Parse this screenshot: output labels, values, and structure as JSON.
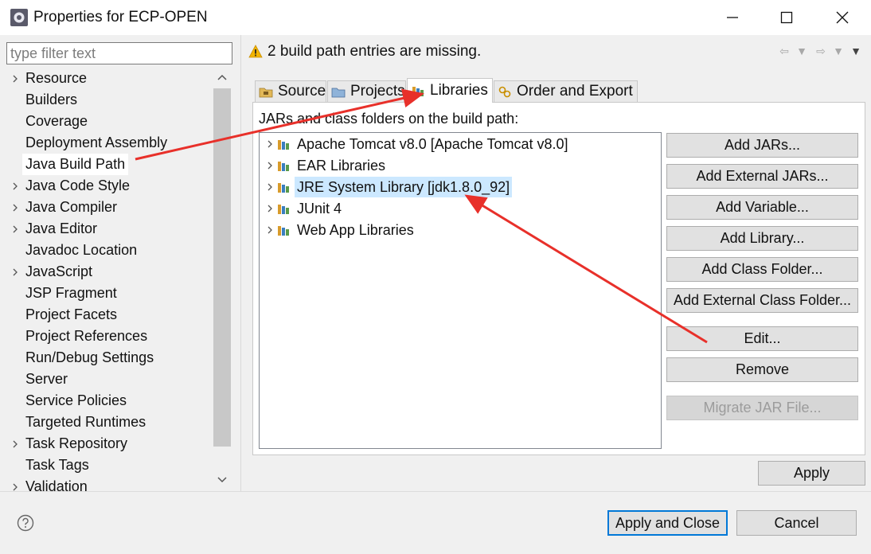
{
  "window": {
    "title": "Properties for ECP-OPEN",
    "minimize": "—",
    "maximize": "☐",
    "close": "✕"
  },
  "filter": {
    "placeholder": "type filter text"
  },
  "nav": {
    "items": [
      {
        "label": "Resource",
        "expandable": true
      },
      {
        "label": "Builders",
        "expandable": false
      },
      {
        "label": "Coverage",
        "expandable": false
      },
      {
        "label": "Deployment Assembly",
        "expandable": false
      },
      {
        "label": "Java Build Path",
        "expandable": false,
        "selected": true
      },
      {
        "label": "Java Code Style",
        "expandable": true
      },
      {
        "label": "Java Compiler",
        "expandable": true
      },
      {
        "label": "Java Editor",
        "expandable": true
      },
      {
        "label": "Javadoc Location",
        "expandable": false
      },
      {
        "label": "JavaScript",
        "expandable": true
      },
      {
        "label": "JSP Fragment",
        "expandable": false
      },
      {
        "label": "Project Facets",
        "expandable": false
      },
      {
        "label": "Project References",
        "expandable": false
      },
      {
        "label": "Run/Debug Settings",
        "expandable": false
      },
      {
        "label": "Server",
        "expandable": false
      },
      {
        "label": "Service Policies",
        "expandable": false
      },
      {
        "label": "Targeted Runtimes",
        "expandable": false
      },
      {
        "label": "Task Repository",
        "expandable": true
      },
      {
        "label": "Task Tags",
        "expandable": false
      },
      {
        "label": "Validation",
        "expandable": true
      }
    ]
  },
  "header": {
    "message": "2 build path entries are missing."
  },
  "tabs": [
    {
      "label": "Source",
      "icon": "source-folder-icon"
    },
    {
      "label": "Projects",
      "icon": "projects-folder-icon"
    },
    {
      "label": "Libraries",
      "icon": "libraries-icon",
      "active": true
    },
    {
      "label": "Order and Export",
      "icon": "order-export-icon"
    }
  ],
  "libraries": {
    "label": "JARs and class folders on the build path:",
    "items": [
      {
        "label": "Apache Tomcat v8.0 [Apache Tomcat v8.0]"
      },
      {
        "label": "EAR Libraries"
      },
      {
        "label": "JRE System Library [jdk1.8.0_92]",
        "selected": true
      },
      {
        "label": "JUnit 4"
      },
      {
        "label": "Web App Libraries"
      }
    ]
  },
  "buttons": {
    "add_jars": "Add JARs...",
    "add_external_jars": "Add External JARs...",
    "add_variable": "Add Variable...",
    "add_library": "Add Library...",
    "add_class_folder": "Add Class Folder...",
    "add_external_class_folder": "Add External Class Folder...",
    "edit": "Edit...",
    "remove": "Remove",
    "migrate_jar": "Migrate JAR File...",
    "apply": "Apply",
    "apply_and_close": "Apply and Close",
    "cancel": "Cancel"
  },
  "colors": {
    "annotation": "#e8302a",
    "selection": "#cce8ff",
    "focus_border": "#0078d7",
    "warning": "#f2b400"
  }
}
